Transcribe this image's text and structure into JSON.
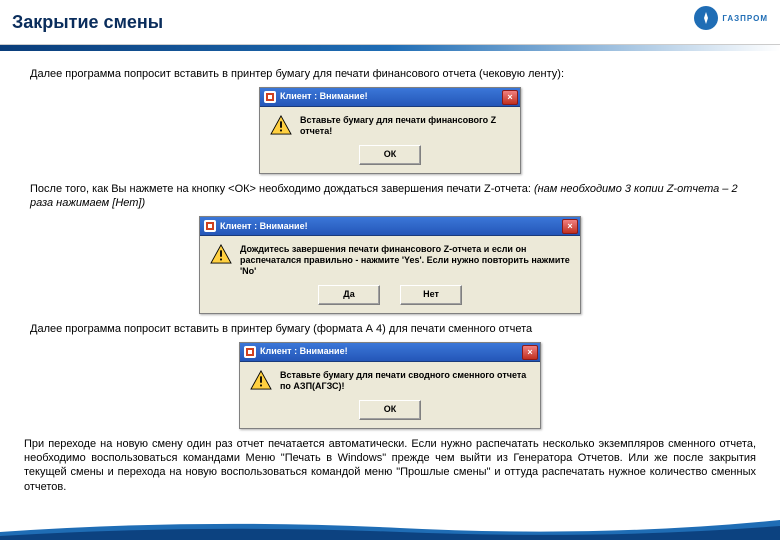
{
  "header": {
    "title": "Закрытие смены",
    "logo_text": "ГАЗПРОМ"
  },
  "p1": "Далее программа попросит вставить в принтер бумагу для печати финансового отчета (чековую ленту):",
  "dialog1": {
    "title": "Клиент : Внимание!",
    "text": "Вставьте бумагу для печати финансового Z отчета!",
    "ok": "ОК"
  },
  "p2a": "После того, как Вы нажмете на кнопку <ОК> необходимо дождаться завершения печати Z-отчета: ",
  "p2b": "(нам необходимо 3 копии Z-отчета – 2 раза нажимаем [Нет])",
  "dialog2": {
    "title": "Клиент : Внимание!",
    "text": "Дождитесь завершения печати финансового Z-отчета и если он распечатался правильно - нажмите 'Yes'. Если нужно повторить нажмите 'No'",
    "yes": "Да",
    "no": "Нет"
  },
  "p3": "Далее программа попросит вставить в принтер бумагу (формата А 4) для печати сменного отчета",
  "dialog3": {
    "title": "Клиент : Внимание!",
    "text": "Вставьте бумагу для печати сводного сменного отчета по АЗП(АГЗС)!",
    "ok": "ОК"
  },
  "p4": "При переходе на новую смену один раз отчет печатается автоматически. Если нужно распечатать несколько экземпляров сменного отчета, необходимо воспользоваться командами Меню \"Печать в Windows\" прежде чем выйти из Генератора Отчетов. Или же после закрытия текущей смены и перехода на новую воспользоваться командой меню \"Прошлые смены\" и оттуда распечатать нужное количество сменных отчетов."
}
